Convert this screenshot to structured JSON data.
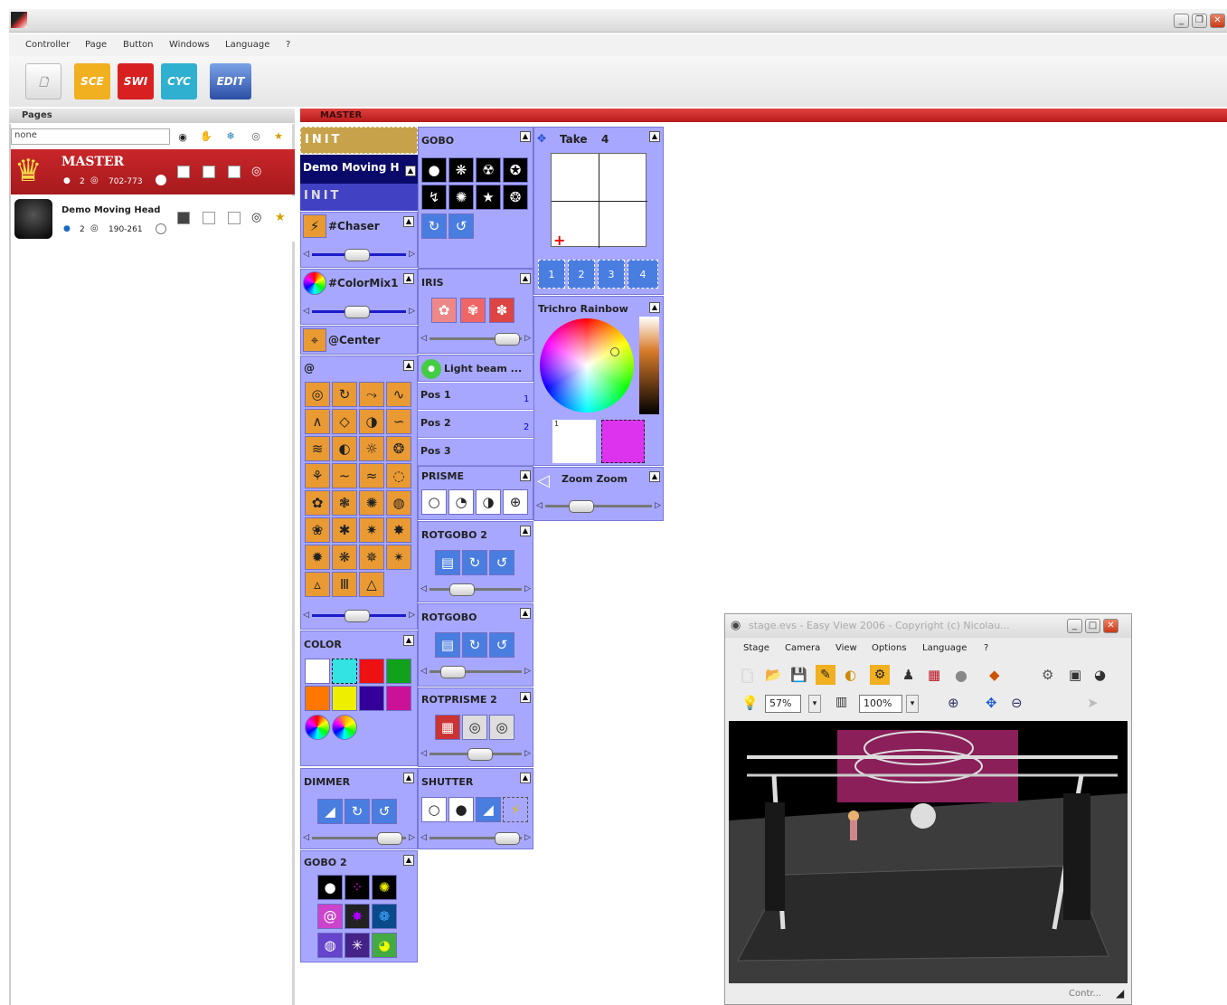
{
  "menu": [
    "Controller",
    "Page",
    "Button",
    "Windows",
    "Language",
    "?"
  ],
  "toolbar": {
    "buttons": [
      "SCE",
      "SWI",
      "CYC",
      "EDIT"
    ]
  },
  "pages": {
    "header": "Pages",
    "filter": "none",
    "master": {
      "name": "MASTER",
      "count": "2",
      "range": "702-773"
    },
    "demo": {
      "name": "Demo Moving Head",
      "count": "2",
      "range": "190-261"
    }
  },
  "master_header": "MASTER",
  "col1": {
    "init_top": "INIT",
    "demo_label": "Demo Moving H",
    "init_sub": "INIT",
    "chaser": "#Chaser",
    "colormix": "#ColorMix1",
    "center": "@Center",
    "at": "@",
    "color": "COLOR",
    "dimmer": "DIMMER",
    "gobo2": "GOBO 2"
  },
  "col2": {
    "gobo": "GOBO",
    "iris": "IRIS",
    "lightbeam": "Light beam ...",
    "pos1": "Pos 1",
    "pos1n": "1",
    "pos2": "Pos 2",
    "pos2n": "2",
    "pos3": "Pos 3",
    "prisme": "PRISME",
    "rotgobo2": "ROTGOBO 2",
    "rotgobo": "ROTGOBO",
    "rotprisme2": "ROTPRISME 2",
    "shutter": "SHUTTER"
  },
  "col3": {
    "take": "Take",
    "take_n": "4",
    "trichro": "Trichro Rainbow",
    "trichro_n": "1",
    "zoom": "Zoom Zoom",
    "take_buttons": [
      "1",
      "2",
      "3",
      "4"
    ]
  },
  "colors": {
    "swatches": [
      "#ffffff",
      "#33e3e3",
      "#ee1111",
      "#11a11a",
      "#ff7700",
      "#eeee00",
      "#330099",
      "#cc1199"
    ],
    "picked": "#dd33ee"
  },
  "stage": {
    "title": "stage.evs - Easy View 2006 - Copyright (c) Nicolau...",
    "menu": [
      "Stage",
      "Camera",
      "View",
      "Options",
      "Language",
      "?"
    ],
    "zoom1": "57%",
    "zoom2": "100%",
    "status": "Contr..."
  }
}
